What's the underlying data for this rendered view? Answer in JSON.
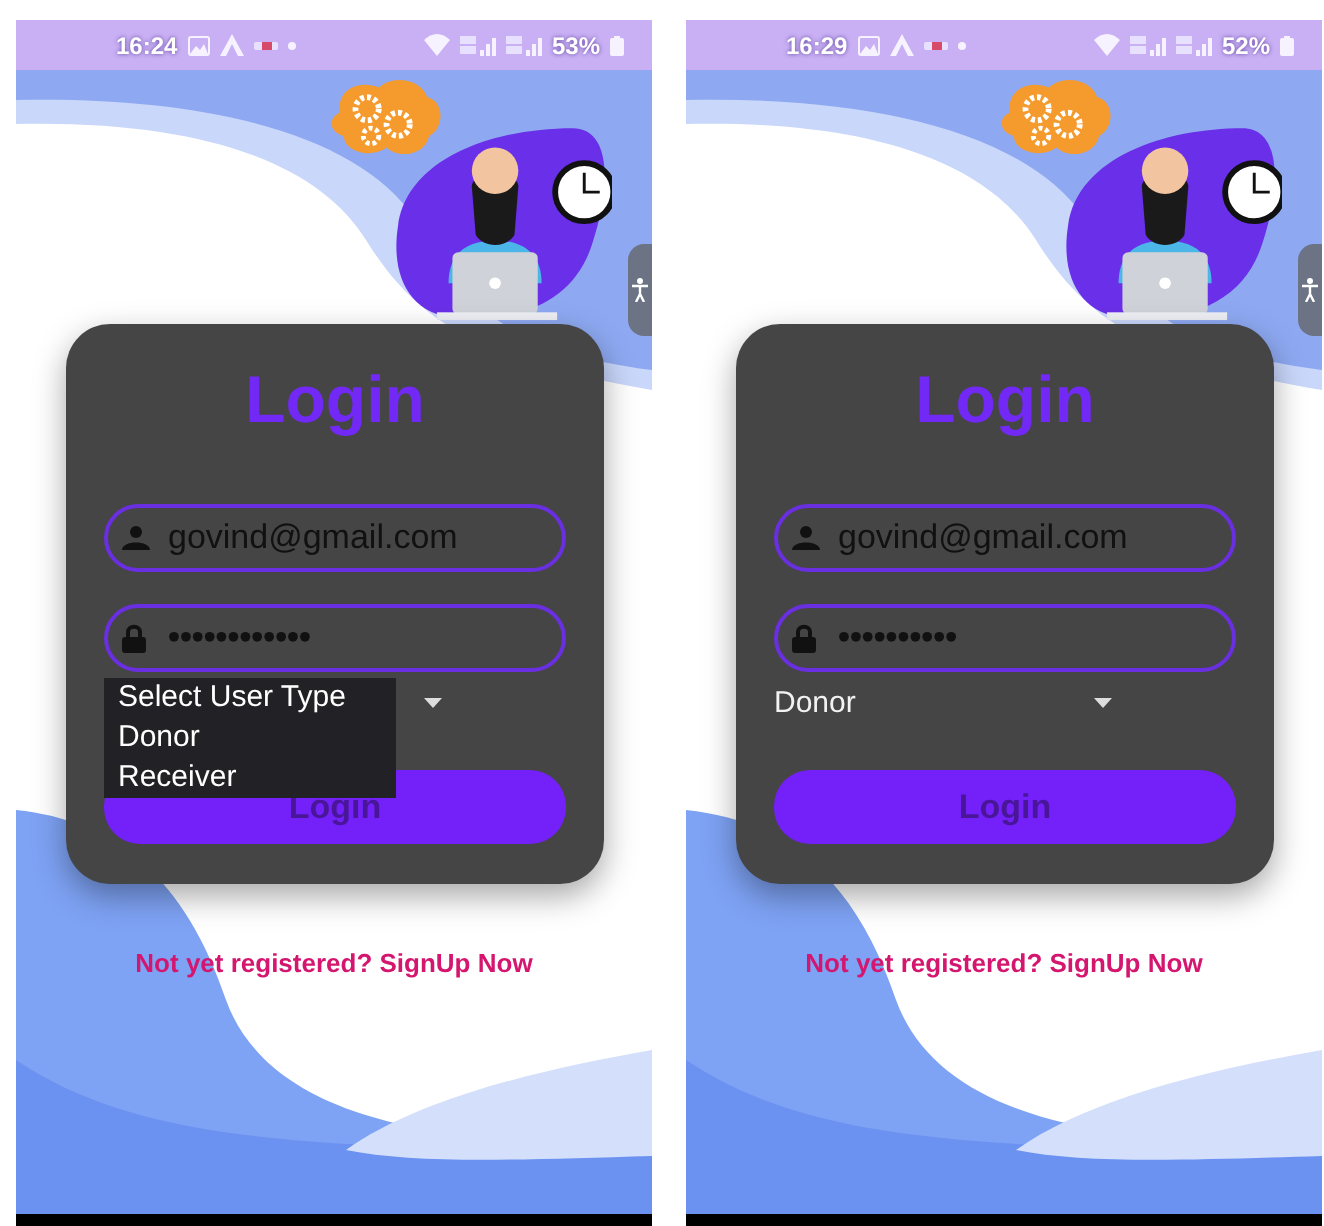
{
  "screens": [
    {
      "status_bar": {
        "time": "16:24",
        "battery": "53%"
      },
      "login": {
        "title": "Login",
        "email": "govind@gmail.com",
        "password": "••••••••••••",
        "user_type": {
          "expanded": true,
          "options": [
            "Select User Type",
            "Donor",
            "Receiver"
          ]
        },
        "button": "Login"
      },
      "signup_link": "Not yet registered? SignUp Now"
    },
    {
      "status_bar": {
        "time": "16:29",
        "battery": "52%"
      },
      "login": {
        "title": "Login",
        "email": "govind@gmail.com",
        "password": "••••••••••",
        "user_type": {
          "expanded": false,
          "value": "Donor"
        },
        "button": "Login"
      },
      "signup_link": "Not yet registered? SignUp Now"
    }
  ]
}
